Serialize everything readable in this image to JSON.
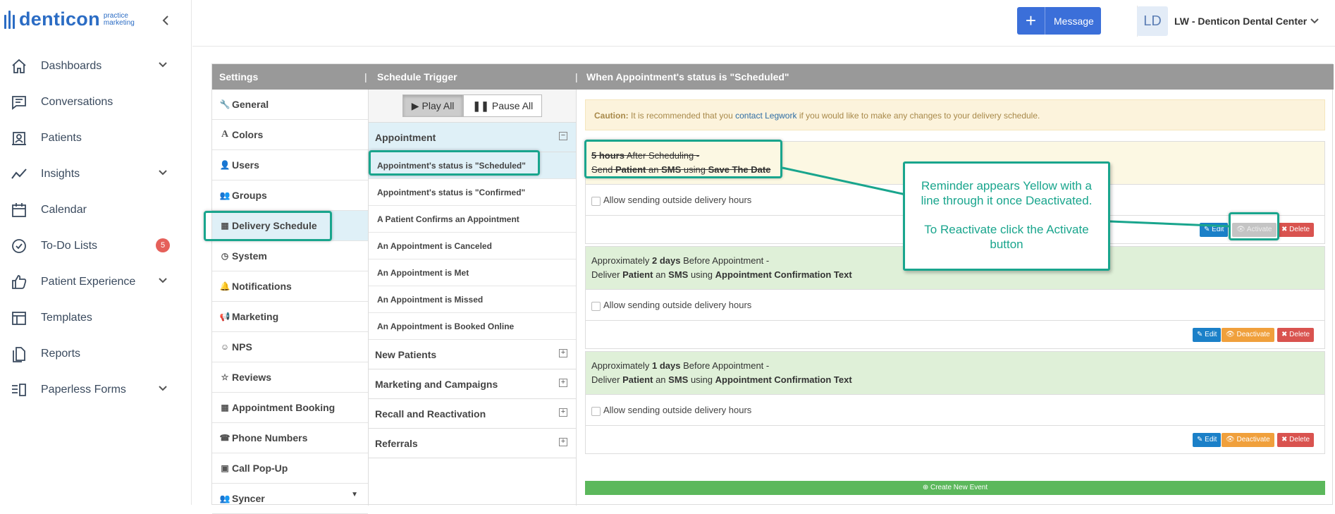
{
  "sidebar": {
    "logo": {
      "word": "denticon",
      "sub1": "practice",
      "sub2": "marketing"
    },
    "items": [
      {
        "label": "Dashboards",
        "icon": "home-icon",
        "has_chevron": true
      },
      {
        "label": "Conversations",
        "icon": "chat-icon",
        "has_chevron": false
      },
      {
        "label": "Patients",
        "icon": "patient-card-icon",
        "has_chevron": false
      },
      {
        "label": "Insights",
        "icon": "trend-icon",
        "has_chevron": true
      },
      {
        "label": "Calendar",
        "icon": "calendar-icon",
        "has_chevron": false
      },
      {
        "label": "To-Do Lists",
        "icon": "check-circle-icon",
        "has_chevron": false,
        "badge": "5"
      },
      {
        "label": "Patient Experience",
        "icon": "thumbs-up-icon",
        "has_chevron": true
      },
      {
        "label": "Templates",
        "icon": "table-icon",
        "has_chevron": false
      },
      {
        "label": "Reports",
        "icon": "document-icon",
        "has_chevron": false
      },
      {
        "label": "Paperless Forms",
        "icon": "form-icon",
        "has_chevron": true
      }
    ]
  },
  "topbar": {
    "message_label": "Message",
    "avatar_initials": "LD",
    "account_name": "LW - Denticon Dental Center"
  },
  "panel": {
    "headers": {
      "settings": "Settings",
      "trigger": "Schedule Trigger",
      "when": "When Appointment's status is \"Scheduled\""
    },
    "settings_items": [
      {
        "label": "General",
        "icon": "wrench-icon"
      },
      {
        "label": "Colors",
        "icon": "font-icon"
      },
      {
        "label": "Users",
        "icon": "user-icon"
      },
      {
        "label": "Groups",
        "icon": "users-icon"
      },
      {
        "label": "Delivery Schedule",
        "icon": "calendar-small-icon"
      },
      {
        "label": "System",
        "icon": "clock-icon"
      },
      {
        "label": "Notifications",
        "icon": "bell-icon"
      },
      {
        "label": "Marketing",
        "icon": "bullhorn-icon"
      },
      {
        "label": "NPS",
        "icon": "smile-icon"
      },
      {
        "label": "Reviews",
        "icon": "star-half-icon"
      },
      {
        "label": "Appointment Booking",
        "icon": "calendar-small-icon"
      },
      {
        "label": "Phone Numbers",
        "icon": "phone-icon"
      },
      {
        "label": "Call Pop-Up",
        "icon": "window-icon"
      },
      {
        "label": "Syncer",
        "icon": "users-icon"
      }
    ],
    "play_all": "Play All",
    "pause_all": "Pause All",
    "group_appointment": "Appointment",
    "triggers": [
      "Appointment's status is \"Scheduled\"",
      "Appointment's status is \"Confirmed\"",
      "A Patient Confirms an Appointment",
      "An Appointment is Canceled",
      "An Appointment is Met",
      "An Appointment is Missed",
      "An Appointment is Booked Online"
    ],
    "other_groups": [
      "New Patients",
      "Marketing and Campaigns",
      "Recall and Reactivation",
      "Referrals"
    ],
    "caution": {
      "bold": "Caution:",
      "pre": "It is recommended that you",
      "link": "contact Legwork",
      "post": "if you would like to make any changes to your delivery schedule."
    },
    "events": [
      {
        "time": "5 hours",
        "when": "After Scheduling -",
        "verb": "Send",
        "who": "Patient",
        "via_word": "an",
        "channel": "SMS",
        "using": "using",
        "template": "Save The Date",
        "state": "deactivated"
      },
      {
        "prefix": "Approximately",
        "time": "2 days",
        "when": "Before Appointment -",
        "verb": "Deliver",
        "who": "Patient",
        "via_word": "an",
        "channel": "SMS",
        "using": "using",
        "template": "Appointment Confirmation Text",
        "state": "active"
      },
      {
        "prefix": "Approximately",
        "time": "1 days",
        "when": "Before Appointment -",
        "verb": "Deliver",
        "who": "Patient",
        "via_word": "an",
        "channel": "SMS",
        "using": "using",
        "template": "Appointment Confirmation Text",
        "state": "active"
      }
    ],
    "allow_outside": "Allow sending outside delivery hours",
    "btn_edit": "Edit",
    "btn_deactivate": "Deactivate",
    "btn_activate": "Activate",
    "btn_delete": "Delete",
    "create_event": "Create New Event"
  },
  "callout": {
    "line1": "Reminder appears Yellow with a line through it once Deactivated.",
    "line2": "To Reactivate click the Activate button"
  },
  "colors": {
    "accent": "#2b6cc4",
    "highlight": "#19a58d",
    "header_gray": "#999999",
    "edit": "#1b80c8",
    "deactivate": "#f0a03c",
    "delete": "#d9534f",
    "create": "#5cb85c"
  }
}
